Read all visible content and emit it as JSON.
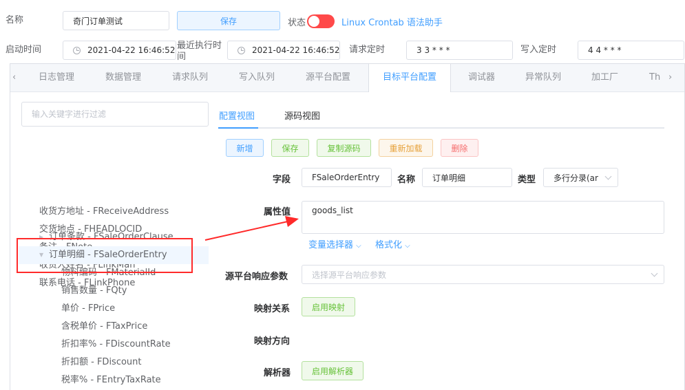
{
  "top": {
    "name_label": "名称",
    "name_value": "奇门订单测试",
    "save_label": "保存",
    "status_label": "状态",
    "crontab_link": "Linux Crontab 语法助手",
    "start_time_label": "启动时间",
    "start_time_value": "2021-04-22 16:46:52",
    "last_exec_label": "最近执行时间",
    "last_exec_value": "2021-04-22 16:46:52",
    "request_cron_label": "请求定时",
    "request_cron_value": "3 3 * * *",
    "write_cron_label": "写入定时",
    "write_cron_value": "4 4 * * *"
  },
  "tabs": [
    "日志管理",
    "数据管理",
    "请求队列",
    "写入队列",
    "源平台配置",
    "目标平台配置",
    "调试器",
    "异常队列",
    "加工厂",
    "Th"
  ],
  "active_tab": "目标平台配置",
  "tree": {
    "filter_placeholder": "输入关键字进行过滤",
    "nodes": [
      "收货方地址 - FReceiveAddress",
      "交货地点 - FHEADLOCID",
      "备注 - FNote",
      "收货人姓名 - FLinkMan",
      "联系电话 - FLinkPhone",
      "订单条款 - FSaleOrderClause",
      "订单明细 - FSaleOrderEntry",
      "物料编码 - FMaterialId",
      "销售数量 - FQty",
      "单价 - FPrice",
      "含税单价 - FTaxPrice",
      "折扣率% - FDiscountRate",
      "折扣额 - FDiscount",
      "税率% - FEntryTaxRate"
    ]
  },
  "editor": {
    "subtabs": [
      "配置视图",
      "源码视图"
    ],
    "buttons": {
      "add": "新增",
      "save": "保存",
      "copy": "复制源码",
      "reload": "重新加载",
      "delete": "删除"
    },
    "field_label": "字段",
    "field_value": "FSaleOrderEntry",
    "name_label": "名称",
    "name_value": "订单明细",
    "type_label": "类型",
    "type_value": "多行分录(ar",
    "attr_label": "属性值",
    "attr_value": "goods_list",
    "var_selector": "变量选择器",
    "format": "格式化",
    "src_resp_label": "源平台响应参数",
    "src_resp_placeholder": "选择源平台响应参数",
    "mapping_label": "映射关系",
    "mapping_btn": "启用映射",
    "direction_label": "映射方向",
    "parser_label": "解析器",
    "parser_btn": "启用解析器"
  },
  "colors": {
    "accent": "#409eff",
    "switch_off": "#ff4949",
    "annotation": "#ff2a2a"
  }
}
